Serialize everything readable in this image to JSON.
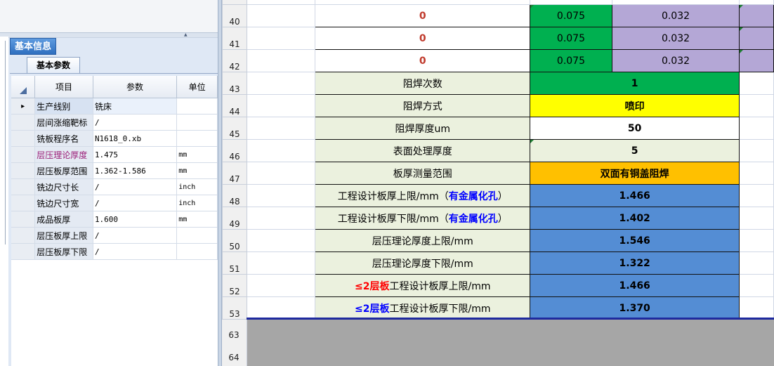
{
  "left_panel": {
    "info_tab": "基本信息",
    "params_tab": "基本参数",
    "splitter_grip": "▲ ■■■■■■■■■",
    "columns": {
      "item": "项目",
      "value": "参数",
      "unit": "单位"
    },
    "rows": [
      {
        "marker": "▸",
        "item": "生产线别",
        "value": "铣床",
        "unit": ""
      },
      {
        "marker": "",
        "item": "层间涨缩靶标",
        "value": "/",
        "unit": ""
      },
      {
        "marker": "",
        "item": "铣板程序名",
        "value": "N1618_0.xb",
        "unit": ""
      },
      {
        "marker": "",
        "item": "层压理论厚度",
        "value": "1.475",
        "unit": "mm"
      },
      {
        "marker": "",
        "item": "层压板厚范围",
        "value": "1.362-1.586",
        "unit": "mm"
      },
      {
        "marker": "",
        "item": "铣边尺寸长",
        "value": "/",
        "unit": "inch"
      },
      {
        "marker": "",
        "item": "铣边尺寸宽",
        "value": "/",
        "unit": "inch"
      },
      {
        "marker": "",
        "item": "成品板厚",
        "value": "1.600",
        "unit": "mm"
      },
      {
        "marker": "",
        "item": "层压板厚上限",
        "value": "/",
        "unit": ""
      },
      {
        "marker": "",
        "item": "层压板厚下限",
        "value": "/",
        "unit": ""
      }
    ],
    "highlight_color": "#9c1f78"
  },
  "sheet": {
    "rows": [
      {
        "num": "40",
        "label": "0",
        "v1": "0.075",
        "v2": "0.032"
      },
      {
        "num": "41",
        "label": "0",
        "v1": "0.075",
        "v2": "0.032"
      },
      {
        "num": "42",
        "label": "0",
        "v1": "0.075",
        "v2": "0.032"
      },
      {
        "num": "43",
        "label": "阻焊次数",
        "value": "1"
      },
      {
        "num": "44",
        "label": "阻焊方式",
        "value": "喷印"
      },
      {
        "num": "45",
        "label": "阻焊厚度um",
        "value": "50"
      },
      {
        "num": "46",
        "label": "表面处理厚度",
        "value": "5"
      },
      {
        "num": "47",
        "label": "板厚测量范围",
        "value": "双面有铜盖阻焊"
      },
      {
        "num": "48",
        "label": "工程设计板厚上限/mm（",
        "label_hl": "有金属化孔",
        "label_end": "）",
        "value": "1.466"
      },
      {
        "num": "49",
        "label": "工程设计板厚下限/mm（",
        "label_hl": "有金属化孔",
        "label_end": "）",
        "value": "1.402"
      },
      {
        "num": "50",
        "label": "层压理论厚度上限/mm",
        "value": "1.546"
      },
      {
        "num": "51",
        "label": "层压理论厚度下限/mm",
        "value": "1.322"
      },
      {
        "num": "52",
        "label_hl": "≤2层板",
        "label": "工程设计板厚上限/mm",
        "value": "1.466"
      },
      {
        "num": "53",
        "label_hl": "≤2层板",
        "label": "工程设计板厚下限/mm",
        "value": "1.370"
      }
    ],
    "hidden_rows": [
      "63",
      "64"
    ],
    "colors": {
      "green": "#00b050",
      "purple": "#b4a7d6",
      "light_green": "#ebf1de",
      "yellow": "#ffff00",
      "orange": "#ffc000",
      "blue": "#548dd4",
      "red_text": "#ff0000",
      "blue_text": "#0000ff"
    }
  }
}
